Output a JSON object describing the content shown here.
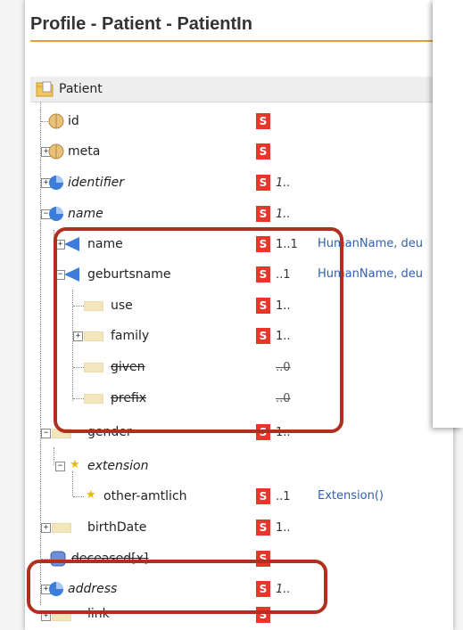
{
  "title": "Profile - Patient - PatientIn",
  "root": {
    "label": "Patient"
  },
  "colors": {
    "flag": "#e8362a",
    "highlight_box": "#b03020",
    "type_link": "#3060b0",
    "title_rule": "#e0a040"
  },
  "rows": [
    {
      "label": "id",
      "flag": "S",
      "card": "",
      "type": ""
    },
    {
      "label": "meta",
      "flag": "S",
      "card": "",
      "type": ""
    },
    {
      "label": "identifier",
      "flag": "S",
      "card": "1..",
      "type": ""
    },
    {
      "label": "name",
      "flag": "S",
      "card": "1..",
      "type": ""
    },
    {
      "label": "name",
      "flag": "S",
      "card": "1..1",
      "type": "HumanName, deu"
    },
    {
      "label": "geburtsname",
      "flag": "S",
      "card": "..1",
      "type": "HumanName, deu"
    },
    {
      "label": "use",
      "flag": "S",
      "card": "1..",
      "type": ""
    },
    {
      "label": "family",
      "flag": "S",
      "card": "1..",
      "type": ""
    },
    {
      "label": "given",
      "flag": "",
      "card": "..0",
      "type": ""
    },
    {
      "label": "prefix",
      "flag": "",
      "card": "..0",
      "type": ""
    },
    {
      "label": "gender",
      "flag": "S",
      "card": "1..",
      "type": ""
    },
    {
      "label": "extension",
      "flag": "",
      "card": "",
      "type": ""
    },
    {
      "label": "other-amtlich",
      "flag": "S",
      "card": "..1",
      "type": "Extension()"
    },
    {
      "label": "birthDate",
      "flag": "S",
      "card": "1..",
      "type": ""
    },
    {
      "label": "deceased[x]",
      "flag": "S",
      "card": "",
      "type": ""
    },
    {
      "label": "address",
      "flag": "S",
      "card": "1..",
      "type": ""
    },
    {
      "label": "link",
      "flag": "S",
      "card": "",
      "type": ""
    }
  ]
}
